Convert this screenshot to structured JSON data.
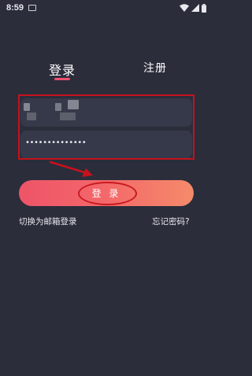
{
  "status_bar": {
    "time": "8:59"
  },
  "tabs": [
    {
      "label": "登录",
      "active": true
    },
    {
      "label": "注册",
      "active": false
    }
  ],
  "form": {
    "password_value": "••••••••••••••"
  },
  "login_button": {
    "label": "登 录"
  },
  "links": {
    "switch_to_email": "切换为邮箱登录",
    "forgot_password": "忘记密码?"
  },
  "colors": {
    "background": "#2b2d3b",
    "field_bg": "#363949",
    "accent": "#ef4f6e",
    "annotation_red": "#c6121c"
  }
}
